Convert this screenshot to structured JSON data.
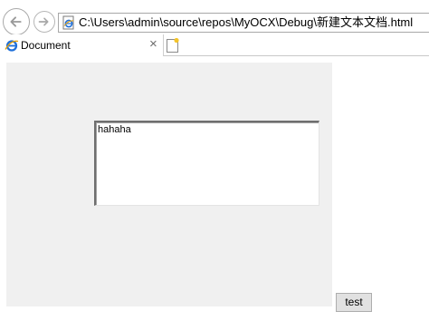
{
  "address_bar": {
    "url": "C:\\Users\\admin\\source\\repos\\MyOCX\\Debug\\新建文本文档.html",
    "page_icon": "ie-page-icon"
  },
  "navigation": {
    "back_icon": "back-arrow-icon",
    "forward_icon": "forward-arrow-icon"
  },
  "tab": {
    "label": "Document",
    "icon": "ie-logo-icon",
    "close_glyph": "×",
    "new_tab_icon": "new-tab-icon"
  },
  "content": {
    "textarea_text": "hahaha",
    "button_label": "test"
  },
  "colors": {
    "control_background": "#f0f0f0",
    "button_background": "#e1e1e1",
    "ie_blue": "#1e6fd9"
  }
}
